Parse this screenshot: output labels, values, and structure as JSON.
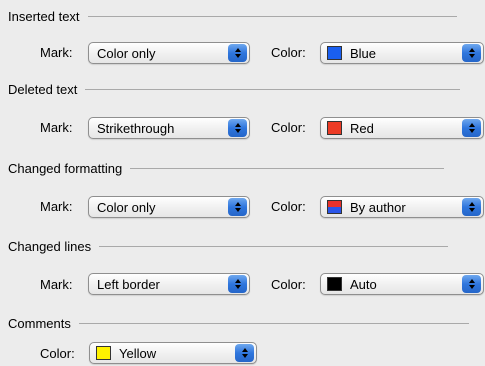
{
  "sections": {
    "inserted": {
      "title": "Inserted text",
      "mark_label": "Mark:",
      "mark_value": "Color only",
      "color_label": "Color:",
      "color_value": "Blue",
      "swatch": "#1a5ff0"
    },
    "deleted": {
      "title": "Deleted text",
      "mark_label": "Mark:",
      "mark_value": "Strikethrough",
      "color_label": "Color:",
      "color_value": "Red",
      "swatch": "#ec3b25"
    },
    "formatting": {
      "title": "Changed formatting",
      "mark_label": "Mark:",
      "mark_value": "Color only",
      "color_label": "Color:",
      "color_value": "By author",
      "swatch_top": "#e8312a",
      "swatch_bottom": "#2a55e8"
    },
    "lines": {
      "title": "Changed lines",
      "mark_label": "Mark:",
      "mark_value": "Left border",
      "color_label": "Color:",
      "color_value": "Auto",
      "swatch": "#000000"
    },
    "comments": {
      "title": "Comments",
      "color_label": "Color:",
      "color_value": "Yellow",
      "swatch": "#fff200"
    }
  }
}
